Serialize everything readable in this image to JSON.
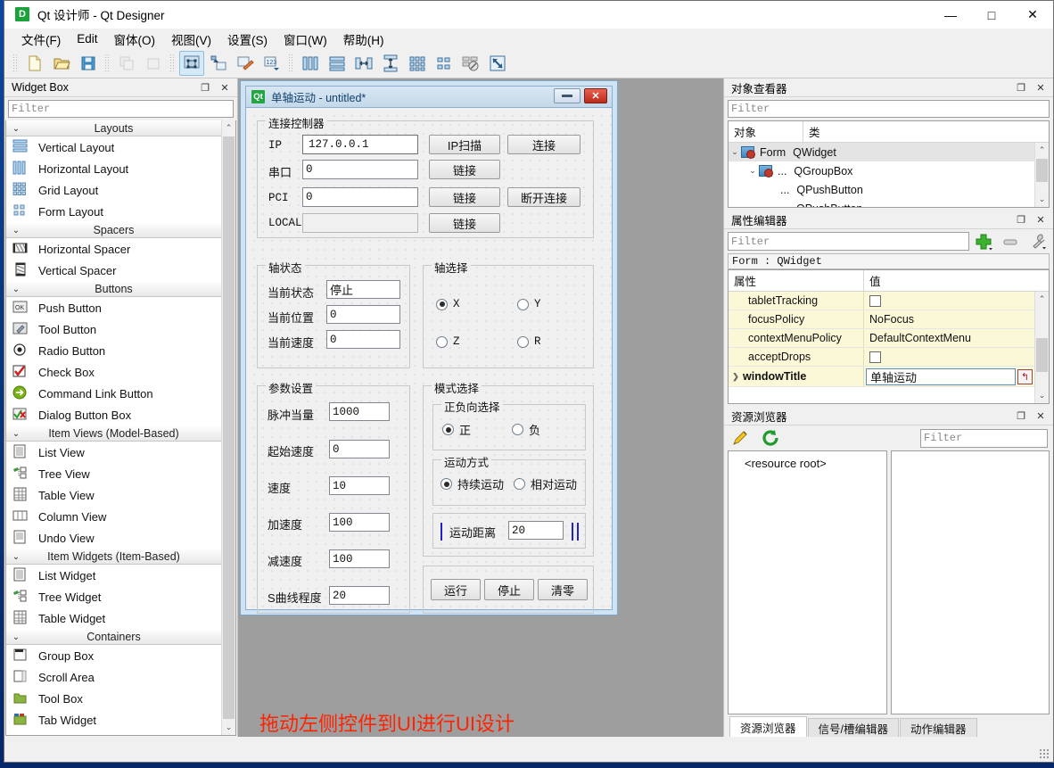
{
  "window": {
    "app_icon_label": "D",
    "title": "Qt 设计师 - Qt Designer",
    "minimize": "—",
    "maximize": "□",
    "close": "✕"
  },
  "menu": [
    {
      "label": "文件(F)"
    },
    {
      "label": "Edit"
    },
    {
      "label": "窗体(O)"
    },
    {
      "label": "视图(V)"
    },
    {
      "label": "设置(S)"
    },
    {
      "label": "窗口(W)"
    },
    {
      "label": "帮助(H)"
    }
  ],
  "toolbar": {
    "groups": [
      {
        "items": [
          {
            "name": "new-form-icon",
            "title": "新建"
          },
          {
            "name": "open-form-icon",
            "title": "打开"
          },
          {
            "name": "save-form-icon",
            "title": "保存"
          }
        ]
      },
      {
        "items": [
          {
            "name": "undo-icon",
            "title": "撤销",
            "disabled": true
          },
          {
            "name": "redo-icon",
            "title": "重做",
            "disabled": true
          }
        ]
      },
      {
        "items": [
          {
            "name": "edit-widgets-icon",
            "title": "编辑控件",
            "active": true
          },
          {
            "name": "edit-signals-slots-icon",
            "title": "编辑信号/槽"
          },
          {
            "name": "edit-buddies-icon",
            "title": "编辑伙伴"
          },
          {
            "name": "edit-tab-order-icon",
            "title": "编辑Tab顺序"
          }
        ]
      },
      {
        "items": [
          {
            "name": "layout-horizontally-icon",
            "title": "水平布局"
          },
          {
            "name": "layout-vertically-icon",
            "title": "垂直布局"
          },
          {
            "name": "layout-splitter-h-icon",
            "title": "水平分裂器布局"
          },
          {
            "name": "layout-splitter-v-icon",
            "title": "垂直分裂器布局"
          },
          {
            "name": "layout-grid-icon",
            "title": "栅格布局"
          },
          {
            "name": "layout-form-icon",
            "title": "窗体布局"
          },
          {
            "name": "break-layout-icon",
            "title": "打破布局"
          },
          {
            "name": "adjust-size-icon",
            "title": "调整大小"
          }
        ]
      }
    ]
  },
  "widget_box": {
    "title": "Widget Box",
    "float_btn": "❐",
    "close_btn": "✕",
    "filter_placeholder": "Filter",
    "groups": [
      {
        "label": "Layouts",
        "items": [
          {
            "label": "Vertical Layout",
            "icon": "vertical-layout-icon"
          },
          {
            "label": "Horizontal Layout",
            "icon": "horizontal-layout-icon"
          },
          {
            "label": "Grid Layout",
            "icon": "grid-layout-icon"
          },
          {
            "label": "Form Layout",
            "icon": "form-layout-icon"
          }
        ]
      },
      {
        "label": "Spacers",
        "items": [
          {
            "label": "Horizontal Spacer",
            "icon": "horizontal-spacer-icon"
          },
          {
            "label": "Vertical Spacer",
            "icon": "vertical-spacer-icon"
          }
        ]
      },
      {
        "label": "Buttons",
        "items": [
          {
            "label": "Push Button",
            "icon": "push-button-icon"
          },
          {
            "label": "Tool Button",
            "icon": "tool-button-icon"
          },
          {
            "label": "Radio Button",
            "icon": "radio-button-icon"
          },
          {
            "label": "Check Box",
            "icon": "check-box-icon"
          },
          {
            "label": "Command Link Button",
            "icon": "command-link-button-icon"
          },
          {
            "label": "Dialog Button Box",
            "icon": "dialog-button-box-icon"
          }
        ]
      },
      {
        "label": "Item Views (Model-Based)",
        "items": [
          {
            "label": "List View",
            "icon": "list-view-icon"
          },
          {
            "label": "Tree View",
            "icon": "tree-view-icon"
          },
          {
            "label": "Table View",
            "icon": "table-view-icon"
          },
          {
            "label": "Column View",
            "icon": "column-view-icon"
          },
          {
            "label": "Undo View",
            "icon": "undo-view-icon"
          }
        ]
      },
      {
        "label": "Item Widgets (Item-Based)",
        "items": [
          {
            "label": "List Widget",
            "icon": "list-widget-icon"
          },
          {
            "label": "Tree Widget",
            "icon": "tree-widget-icon"
          },
          {
            "label": "Table Widget",
            "icon": "table-widget-icon"
          }
        ]
      },
      {
        "label": "Containers",
        "items": [
          {
            "label": "Group Box",
            "icon": "group-box-icon"
          },
          {
            "label": "Scroll Area",
            "icon": "scroll-area-icon"
          },
          {
            "label": "Tool Box",
            "icon": "tool-box-icon"
          },
          {
            "label": "Tab Widget",
            "icon": "tab-widget-icon"
          }
        ]
      }
    ]
  },
  "canvas": {
    "hint": "拖动左侧控件到UI进行UI设计"
  },
  "form": {
    "icon_label": "Qt",
    "title": "单轴运动 - untitled*",
    "minimize": "",
    "close": "✕",
    "connection_group": {
      "title": "连接控制器",
      "rows": [
        {
          "label": "IP",
          "value": "127.0.0.1",
          "kind": "combo",
          "buttons": [
            "IP扫描",
            "连接"
          ]
        },
        {
          "label": "串口",
          "value": "0",
          "kind": "field",
          "buttons": [
            "链接"
          ]
        },
        {
          "label": "PCI",
          "value": "0",
          "kind": "field",
          "buttons": [
            "链接",
            "断开连接"
          ]
        },
        {
          "label": "LOCAL",
          "value": "",
          "kind": "field-disabled",
          "buttons": [
            "链接"
          ]
        }
      ]
    },
    "axis_status": {
      "title": "轴状态",
      "rows": [
        {
          "label": "当前状态",
          "value": "停止"
        },
        {
          "label": "当前位置",
          "value": "0"
        },
        {
          "label": "当前速度",
          "value": "0"
        }
      ]
    },
    "axis_select": {
      "title": "轴选择",
      "options": [
        {
          "label": "X",
          "checked": true
        },
        {
          "label": "Y",
          "checked": false
        },
        {
          "label": "Z",
          "checked": false
        },
        {
          "label": "R",
          "checked": false
        }
      ]
    },
    "param_group": {
      "title": "参数设置",
      "rows": [
        {
          "label": "脉冲当量",
          "value": "1000"
        },
        {
          "label": "起始速度",
          "value": "0"
        },
        {
          "label": "速度",
          "value": "10"
        },
        {
          "label": "加速度",
          "value": "100"
        },
        {
          "label": "减速度",
          "value": "100"
        },
        {
          "label": "S曲线程度",
          "value": "20"
        }
      ]
    },
    "mode_group": {
      "title": "模式选择",
      "direction": {
        "title": "正负向选择",
        "options": [
          {
            "label": "正",
            "checked": true
          },
          {
            "label": "负",
            "checked": false
          }
        ]
      },
      "motion": {
        "title": "运动方式",
        "options": [
          {
            "label": "持续运动",
            "checked": true
          },
          {
            "label": "相对运动",
            "checked": false
          }
        ]
      },
      "distance": {
        "label": "运动距离",
        "value": "20"
      }
    },
    "actions": [
      {
        "label": "运行"
      },
      {
        "label": "停止"
      },
      {
        "label": "清零"
      }
    ]
  },
  "object_inspector": {
    "title": "对象查看器",
    "float_btn": "❐",
    "close_btn": "✕",
    "filter_placeholder": "Filter",
    "columns": [
      "对象",
      "类"
    ],
    "rows": [
      {
        "name": "Form",
        "class": "QWidget",
        "depth": 0,
        "expanded": true,
        "has_icon": true,
        "selected": true
      },
      {
        "name": "...",
        "class": "QGroupBox",
        "depth": 1,
        "expanded": true,
        "has_icon": true,
        "selected": false
      },
      {
        "name": "...",
        "class": "QPushButton",
        "depth": 2,
        "expanded": false,
        "has_icon": false,
        "selected": false
      },
      {
        "name": "",
        "class": "QPushButton",
        "depth": 2,
        "expanded": false,
        "has_icon": false,
        "selected": false
      }
    ]
  },
  "property_editor": {
    "title": "属性编辑器",
    "float_btn": "❐",
    "close_btn": "✕",
    "filter_placeholder": "Filter",
    "add_icon": "add-property-icon",
    "remove_icon": "remove-property-icon",
    "config_icon": "configure-icon",
    "class_line": "Form : QWidget",
    "columns": [
      "属性",
      "值"
    ],
    "rows": [
      {
        "name": "tabletTracking",
        "value": "",
        "kind": "checkbox",
        "checked": false
      },
      {
        "name": "focusPolicy",
        "value": "NoFocus",
        "kind": "text"
      },
      {
        "name": "contextMenuPolicy",
        "value": "DefaultContextMenu",
        "kind": "text"
      },
      {
        "name": "acceptDrops",
        "value": "",
        "kind": "checkbox",
        "checked": false
      },
      {
        "name": "windowTitle",
        "value": "单轴运动",
        "kind": "edit",
        "bold": true,
        "expandable": true
      }
    ]
  },
  "resource_browser": {
    "title": "资源浏览器",
    "float_btn": "❐",
    "close_btn": "✕",
    "edit_icon": "edit-resources-icon",
    "reload_icon": "reload-icon",
    "filter_placeholder": "Filter",
    "root_label": "<resource root>"
  },
  "bottom_tabs": [
    {
      "label": "资源浏览器",
      "active": true
    },
    {
      "label": "信号/槽编辑器",
      "active": false
    },
    {
      "label": "动作编辑器",
      "active": false
    }
  ]
}
